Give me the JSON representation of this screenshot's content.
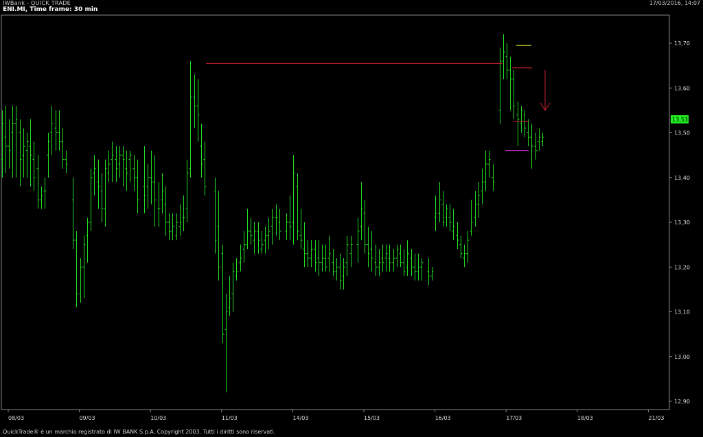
{
  "header": {
    "app_title": "IWBank - QUICK TRADE",
    "datetime": "17/03/2016, 14:07"
  },
  "chart_title": "ENI.MI, Time frame: 30 min",
  "footer": "QuickTrade® è un marchio registrato di IW BANK S.p.A. Copyright 2003. Tutti i diritti sono riservati.",
  "colors": {
    "background": "#000000",
    "bars": "#22dd22",
    "frame": "#8a8a8a",
    "resistance_line": "#cc2233",
    "upper_marker": "#dddd22",
    "lower_marker": "#dd33dd",
    "arrow": "#cc2233",
    "last_price_bg": "#22ee22"
  },
  "chart_data": {
    "type": "ohlc",
    "x_ticks": [
      "08/03",
      "09/03",
      "10/03",
      "11/03",
      "14/03",
      "15/03",
      "16/03",
      "17/03",
      "18/03",
      "21/03"
    ],
    "y_ticks": [
      "13,70",
      "13,60",
      "13,50",
      "13,40",
      "13,30",
      "13,20",
      "13,10",
      "13,00",
      "12,90"
    ],
    "y_tick_values": [
      13.7,
      13.6,
      13.5,
      13.4,
      13.3,
      13.2,
      13.1,
      13.0,
      12.9
    ],
    "ylim": [
      12.88,
      13.75
    ],
    "last_price": "13,53",
    "last_price_value": 13.53,
    "annotations": {
      "resistance_level": 13.655,
      "upper_marker_level": 13.695,
      "mid_marker_level": 13.645,
      "low_marker_level": 13.525,
      "support_marker_level": 13.46,
      "down_arrow": {
        "top": 13.64,
        "bottom": 13.55
      }
    },
    "days": [
      {
        "label": "08/03",
        "bars": [
          [
            13.44,
            13.55,
            13.4,
            13.52
          ],
          [
            13.49,
            13.56,
            13.41,
            13.47
          ],
          [
            13.47,
            13.53,
            13.42,
            13.46
          ],
          [
            13.5,
            13.56,
            13.4,
            13.52
          ],
          [
            13.52,
            13.56,
            13.4,
            13.53
          ],
          [
            13.5,
            13.53,
            13.38,
            13.44
          ],
          [
            13.45,
            13.51,
            13.4,
            13.47
          ],
          [
            13.46,
            13.5,
            13.4,
            13.48
          ],
          [
            13.47,
            13.53,
            13.38,
            13.45
          ],
          [
            13.44,
            13.48,
            13.37,
            13.4
          ],
          [
            13.42,
            13.45,
            13.33,
            13.35
          ],
          [
            13.35,
            13.38,
            13.33,
            13.36
          ],
          [
            13.37,
            13.4,
            13.33,
            13.37
          ],
          [
            13.45,
            13.5,
            13.4,
            13.48
          ],
          [
            13.5,
            13.56,
            13.45,
            13.52
          ],
          [
            13.51,
            13.55,
            13.46,
            13.5
          ],
          [
            13.5,
            13.55,
            13.46,
            13.48
          ],
          [
            13.48,
            13.51,
            13.42,
            13.44
          ],
          [
            13.44,
            13.46,
            13.41,
            13.43
          ]
        ]
      },
      {
        "label": "09/03",
        "bars": [
          [
            13.35,
            13.4,
            13.24,
            13.26
          ],
          [
            13.26,
            13.28,
            13.11,
            13.14
          ],
          [
            13.14,
            13.22,
            13.12,
            13.2
          ],
          [
            13.2,
            13.27,
            13.13,
            13.25
          ],
          [
            13.27,
            13.31,
            13.21,
            13.3
          ],
          [
            13.3,
            13.42,
            13.28,
            13.4
          ],
          [
            13.41,
            13.45,
            13.36,
            13.42
          ],
          [
            13.39,
            13.44,
            13.33,
            13.38
          ],
          [
            13.37,
            13.41,
            13.3,
            13.33
          ],
          [
            13.33,
            13.44,
            13.29,
            13.42
          ],
          [
            13.41,
            13.46,
            13.39,
            13.43
          ],
          [
            13.44,
            13.48,
            13.39,
            13.45
          ],
          [
            13.44,
            13.47,
            13.39,
            13.42
          ],
          [
            13.43,
            13.47,
            13.4,
            13.45
          ],
          [
            13.45,
            13.47,
            13.38,
            13.44
          ],
          [
            13.42,
            13.46,
            13.37,
            13.41
          ],
          [
            13.44,
            13.46,
            13.39,
            13.45
          ],
          [
            13.42,
            13.45,
            13.37,
            13.4
          ],
          [
            13.4,
            13.44,
            13.32,
            13.35
          ]
        ]
      },
      {
        "label": "10/03",
        "bars": [
          [
            13.38,
            13.47,
            13.32,
            13.36
          ],
          [
            13.38,
            13.43,
            13.33,
            13.4
          ],
          [
            13.4,
            13.46,
            13.34,
            13.39
          ],
          [
            13.39,
            13.45,
            13.29,
            13.35
          ],
          [
            13.33,
            13.39,
            13.29,
            13.33
          ],
          [
            13.35,
            13.41,
            13.32,
            13.37
          ],
          [
            13.34,
            13.38,
            13.27,
            13.3
          ],
          [
            13.3,
            13.32,
            13.26,
            13.28
          ],
          [
            13.28,
            13.32,
            13.26,
            13.29
          ],
          [
            13.27,
            13.32,
            13.26,
            13.3
          ],
          [
            13.29,
            13.34,
            13.27,
            13.3
          ],
          [
            13.31,
            13.36,
            13.28,
            13.31
          ],
          [
            13.33,
            13.44,
            13.3,
            13.41
          ],
          [
            13.42,
            13.66,
            13.4,
            13.58
          ],
          [
            13.58,
            13.63,
            13.51,
            13.56
          ],
          [
            13.56,
            13.62,
            13.48,
            13.54
          ],
          [
            13.47,
            13.52,
            13.4,
            13.43
          ],
          [
            13.44,
            13.48,
            13.36,
            13.38
          ]
        ]
      },
      {
        "label": "11/03",
        "bars": [
          [
            13.37,
            13.4,
            13.23,
            13.26
          ],
          [
            13.29,
            13.37,
            13.17,
            13.2
          ],
          [
            13.23,
            13.25,
            13.03,
            13.05
          ],
          [
            13.06,
            13.14,
            12.92,
            13.1
          ],
          [
            13.11,
            13.18,
            13.09,
            13.13
          ],
          [
            13.14,
            13.21,
            13.1,
            13.19
          ],
          [
            13.18,
            13.22,
            13.17,
            13.19
          ],
          [
            13.21,
            13.25,
            13.19,
            13.22
          ],
          [
            13.24,
            13.28,
            13.21,
            13.25
          ],
          [
            13.25,
            13.33,
            13.24,
            13.28
          ],
          [
            13.28,
            13.31,
            13.25,
            13.27
          ],
          [
            13.26,
            13.3,
            13.23,
            13.28
          ],
          [
            13.28,
            13.3,
            13.23,
            13.26
          ],
          [
            13.24,
            13.28,
            13.23,
            13.25
          ],
          [
            13.26,
            13.29,
            13.23,
            13.27
          ],
          [
            13.27,
            13.31,
            13.24,
            13.28
          ],
          [
            13.29,
            13.33,
            13.25,
            13.31
          ],
          [
            13.31,
            13.34,
            13.27,
            13.31
          ],
          [
            13.3,
            13.33,
            13.26,
            13.28
          ]
        ]
      },
      {
        "label": "14/03",
        "bars": [
          [
            13.28,
            13.32,
            13.26,
            13.3
          ],
          [
            13.3,
            13.36,
            13.26,
            13.29
          ],
          [
            13.3,
            13.45,
            13.25,
            13.41
          ],
          [
            13.38,
            13.41,
            13.26,
            13.28
          ],
          [
            13.27,
            13.33,
            13.24,
            13.26
          ],
          [
            13.24,
            13.3,
            13.2,
            13.23
          ],
          [
            13.23,
            13.26,
            13.2,
            13.22
          ],
          [
            13.22,
            13.26,
            13.2,
            13.24
          ],
          [
            13.24,
            13.26,
            13.19,
            13.21
          ],
          [
            13.22,
            13.26,
            13.18,
            13.21
          ],
          [
            13.21,
            13.25,
            13.19,
            13.22
          ],
          [
            13.22,
            13.25,
            13.19,
            13.2
          ],
          [
            13.22,
            13.27,
            13.19,
            13.23
          ],
          [
            13.21,
            13.24,
            13.18,
            13.19
          ],
          [
            13.19,
            13.22,
            13.17,
            13.2
          ],
          [
            13.2,
            13.23,
            13.15,
            13.17
          ],
          [
            13.18,
            13.22,
            13.15,
            13.2
          ],
          [
            13.21,
            13.27,
            13.18,
            13.25
          ],
          [
            13.23,
            13.27,
            13.2,
            13.25
          ]
        ]
      },
      {
        "label": "15/03",
        "bars": [
          [
            13.25,
            13.31,
            13.21,
            13.28
          ],
          [
            13.29,
            13.39,
            13.26,
            13.33
          ],
          [
            13.32,
            13.35,
            13.23,
            13.25
          ],
          [
            13.25,
            13.29,
            13.2,
            13.23
          ],
          [
            13.24,
            13.28,
            13.19,
            13.22
          ],
          [
            13.21,
            13.25,
            13.18,
            13.2
          ],
          [
            13.2,
            13.24,
            13.18,
            13.21
          ],
          [
            13.22,
            13.25,
            13.19,
            13.21
          ],
          [
            13.22,
            13.25,
            13.19,
            13.23
          ],
          [
            13.22,
            13.25,
            13.19,
            13.21
          ],
          [
            13.21,
            13.24,
            13.19,
            13.22
          ],
          [
            13.22,
            13.25,
            13.2,
            13.24
          ],
          [
            13.23,
            13.25,
            13.2,
            13.21
          ],
          [
            13.21,
            13.24,
            13.18,
            13.19
          ],
          [
            13.2,
            13.26,
            13.18,
            13.23
          ],
          [
            13.22,
            13.24,
            13.18,
            13.2
          ],
          [
            13.2,
            13.23,
            13.17,
            13.19
          ],
          [
            13.19,
            13.23,
            13.17,
            13.2
          ],
          [
            13.2,
            13.22,
            13.17,
            13.21
          ]
        ]
      },
      {
        "label": "16/03",
        "bars": [
          [
            13.19,
            13.22,
            13.16,
            13.18
          ],
          [
            13.18,
            13.2,
            13.17,
            13.19
          ],
          [
            13.31,
            13.36,
            13.28,
            13.32
          ],
          [
            13.32,
            13.39,
            13.3,
            13.35
          ],
          [
            13.34,
            13.37,
            13.29,
            13.3
          ],
          [
            13.31,
            13.34,
            13.29,
            13.33
          ],
          [
            13.31,
            13.34,
            13.28,
            13.3
          ],
          [
            13.28,
            13.33,
            13.26,
            13.29
          ],
          [
            13.27,
            13.3,
            13.24,
            13.26
          ],
          [
            13.25,
            13.27,
            13.22,
            13.23
          ],
          [
            13.22,
            13.25,
            13.2,
            13.23
          ],
          [
            13.23,
            13.28,
            13.21,
            13.26
          ],
          [
            13.28,
            13.35,
            13.27,
            13.3
          ],
          [
            13.31,
            13.37,
            13.29,
            13.34
          ],
          [
            13.34,
            13.39,
            13.31,
            13.36
          ],
          [
            13.37,
            13.42,
            13.34,
            13.39
          ],
          [
            13.39,
            13.46,
            13.37,
            13.43
          ],
          [
            13.43,
            13.46,
            13.4,
            13.44
          ],
          [
            13.4,
            13.43,
            13.37,
            13.39
          ]
        ]
      },
      {
        "label": "17/03",
        "bars": [
          [
            13.55,
            13.69,
            13.52,
            13.66
          ],
          [
            13.66,
            13.72,
            13.62,
            13.68
          ],
          [
            13.67,
            13.7,
            13.62,
            13.64
          ],
          [
            13.64,
            13.67,
            13.55,
            13.62
          ],
          [
            13.62,
            13.64,
            13.53,
            13.56
          ],
          [
            13.54,
            13.57,
            13.47,
            13.53
          ],
          [
            13.52,
            13.56,
            13.5,
            13.55
          ],
          [
            13.54,
            13.55,
            13.49,
            13.51
          ],
          [
            13.5,
            13.53,
            13.47,
            13.49
          ],
          [
            13.49,
            13.52,
            13.42,
            13.47
          ],
          [
            13.47,
            13.5,
            13.44,
            13.46
          ],
          [
            13.48,
            13.51,
            13.46,
            13.49
          ],
          [
            13.48,
            13.5,
            13.47,
            13.49
          ]
        ]
      }
    ]
  }
}
